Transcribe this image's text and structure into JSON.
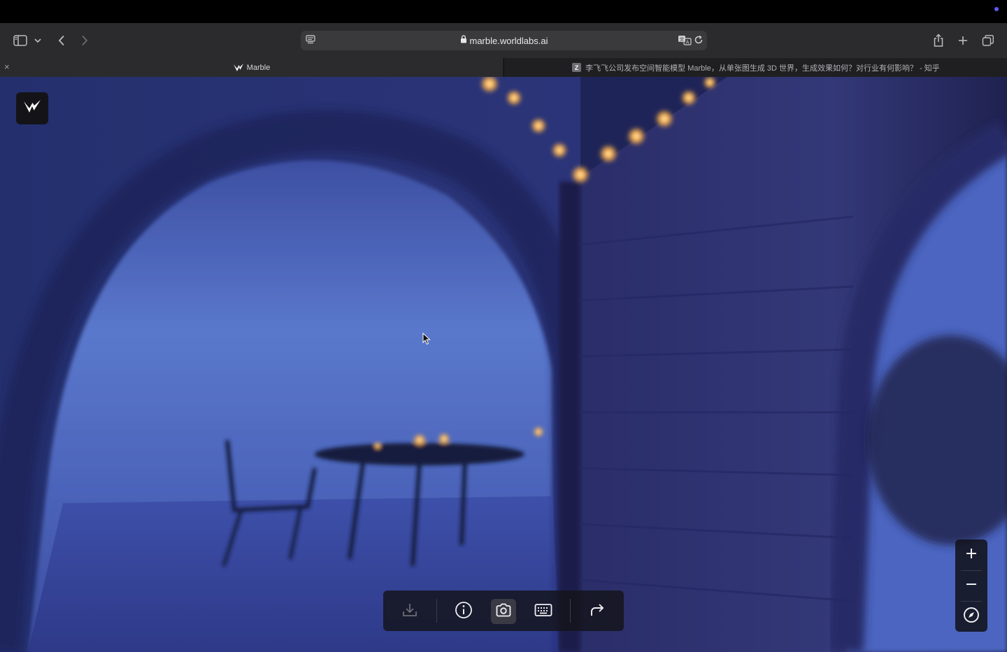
{
  "browser": {
    "url": "marble.worldlabs.ai",
    "tabs": [
      {
        "title": "Marble",
        "active": true
      },
      {
        "title": "李飞飞公司发布空间智能模型 Marble，从单张图生成 3D 世界，生成效果如何？对行业有何影响？ - 知乎",
        "favicon_letter": "Z",
        "active": false
      }
    ],
    "close_glyph": "×",
    "icons": [
      "sidebar-icon",
      "chevron-down-icon",
      "back-icon",
      "forward-icon",
      "page-menu-icon",
      "lock-icon",
      "translate-icon",
      "reload-icon",
      "share-icon",
      "new-tab-icon",
      "tab-overview-icon"
    ]
  },
  "app": {
    "name": "Marble",
    "logo_icon": "marble-logo-icon",
    "bottom_toolbar": [
      {
        "name": "download",
        "icon": "download-icon",
        "enabled": false
      },
      {
        "name": "info",
        "icon": "info-icon",
        "enabled": true
      },
      {
        "name": "camera",
        "icon": "camera-icon",
        "enabled": true,
        "selected": true
      },
      {
        "name": "keyboard",
        "icon": "keyboard-icon",
        "enabled": true
      },
      {
        "name": "share",
        "icon": "share-arrow-icon",
        "enabled": true
      }
    ],
    "zoom_controls": [
      {
        "name": "zoom-in",
        "icon": "plus-icon"
      },
      {
        "name": "zoom-out",
        "icon": "minus-icon"
      },
      {
        "name": "compass",
        "icon": "compass-icon"
      }
    ]
  },
  "colors": {
    "scene_sky": "#4a63b8",
    "scene_wall": "#2a2f6a",
    "lights": "#ffb347",
    "toolbar_bg": "#2b2b2d",
    "accent_dot": "#5b5bf5"
  }
}
